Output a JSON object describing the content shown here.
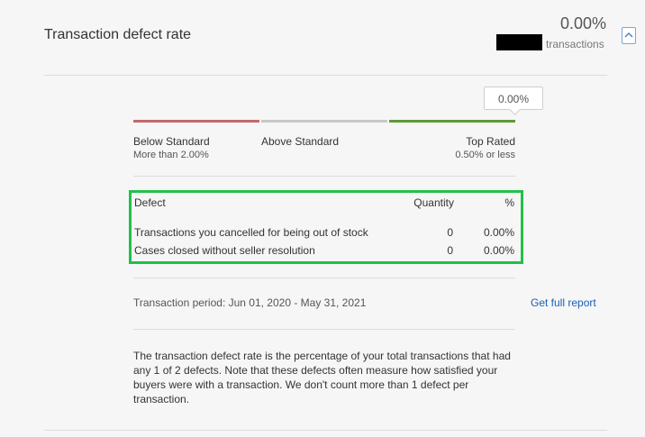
{
  "header": {
    "title": "Transaction defect rate",
    "rate": "0.00%",
    "transactions_label": "transactions"
  },
  "scale": {
    "current_value": "0.00%",
    "levels": [
      {
        "name": "Below Standard",
        "detail": "More than 2.00%",
        "color": "#c46a6a"
      },
      {
        "name": "Above Standard",
        "detail": "",
        "color": "#c8c8c8"
      },
      {
        "name": "Top Rated",
        "detail": "0.50% or less",
        "color": "#5d9a35"
      }
    ]
  },
  "defects": {
    "highlight_color": "#22c048",
    "headers": {
      "defect": "Defect",
      "quantity": "Quantity",
      "percent": "%"
    },
    "rows": [
      {
        "defect": "Transactions you cancelled for being out of stock",
        "quantity": "0",
        "percent": "0.00%"
      },
      {
        "defect": "Cases closed without seller resolution",
        "quantity": "0",
        "percent": "0.00%"
      }
    ]
  },
  "period": {
    "text": "Transaction period: Jun 01, 2020 - May 31, 2021",
    "report_link": "Get full report"
  },
  "description": "The transaction defect rate is the percentage of your total transactions that had any 1 of 2 defects. Note that these defects often measure how satisfied your buyers were with a transaction. We don't count more than 1 defect per transaction.",
  "icons": {
    "collapse": "chevron-up-icon"
  },
  "colors": {
    "link": "#1a5fb4"
  }
}
